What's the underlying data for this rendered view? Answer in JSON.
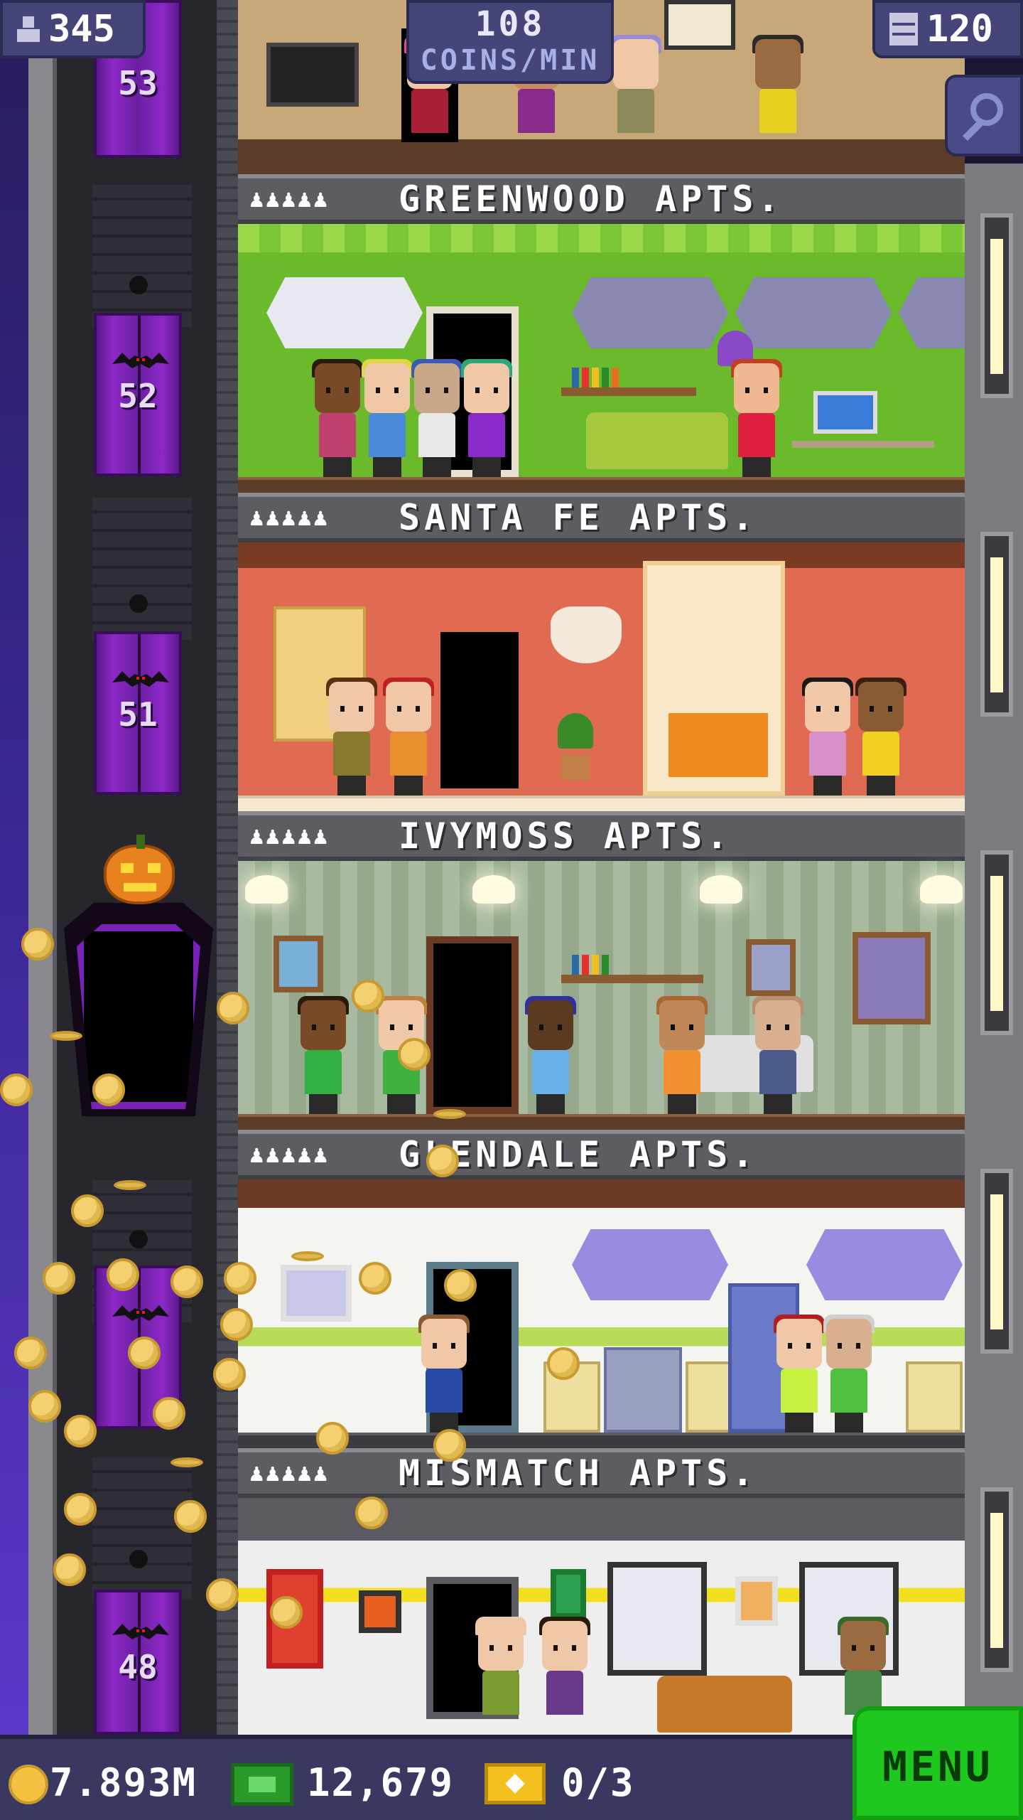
{
  "hud": {
    "population": "345",
    "rate_value": "108",
    "rate_label": "COINS/MIN",
    "floors": "120"
  },
  "elevator_floors": [
    "53",
    "52",
    "51",
    "48"
  ],
  "floors": [
    {
      "name": "GREENWOOD APTS.",
      "rating": "♟♟♟♟♟"
    },
    {
      "name": "SANTA FE APTS.",
      "rating": "♟♟♟♟♟"
    },
    {
      "name": "IVYMOSS APTS.",
      "rating": "♟♟♟♟♟"
    },
    {
      "name": "GLENDALE APTS.",
      "rating": "♟♟♟♟♟"
    },
    {
      "name": "MISMATCH APTS.",
      "rating": "♟♟♟♟♟"
    }
  ],
  "bottom_bar": {
    "coins": "7.893M",
    "bux": "12,679",
    "tickets": "0/3",
    "menu_label": "MENU"
  },
  "icons": {
    "population": "person-icon",
    "floors": "building-icon",
    "search": "magnifier-icon",
    "coins": "coin-icon",
    "bux": "tower-bux-icon",
    "tickets": "golden-ticket-icon"
  },
  "colors": {
    "hud_bg": "#45457a",
    "menu_green": "#1fc81f",
    "coin_gold": "#f4d070",
    "elevator_purple": "#8c28c8"
  }
}
